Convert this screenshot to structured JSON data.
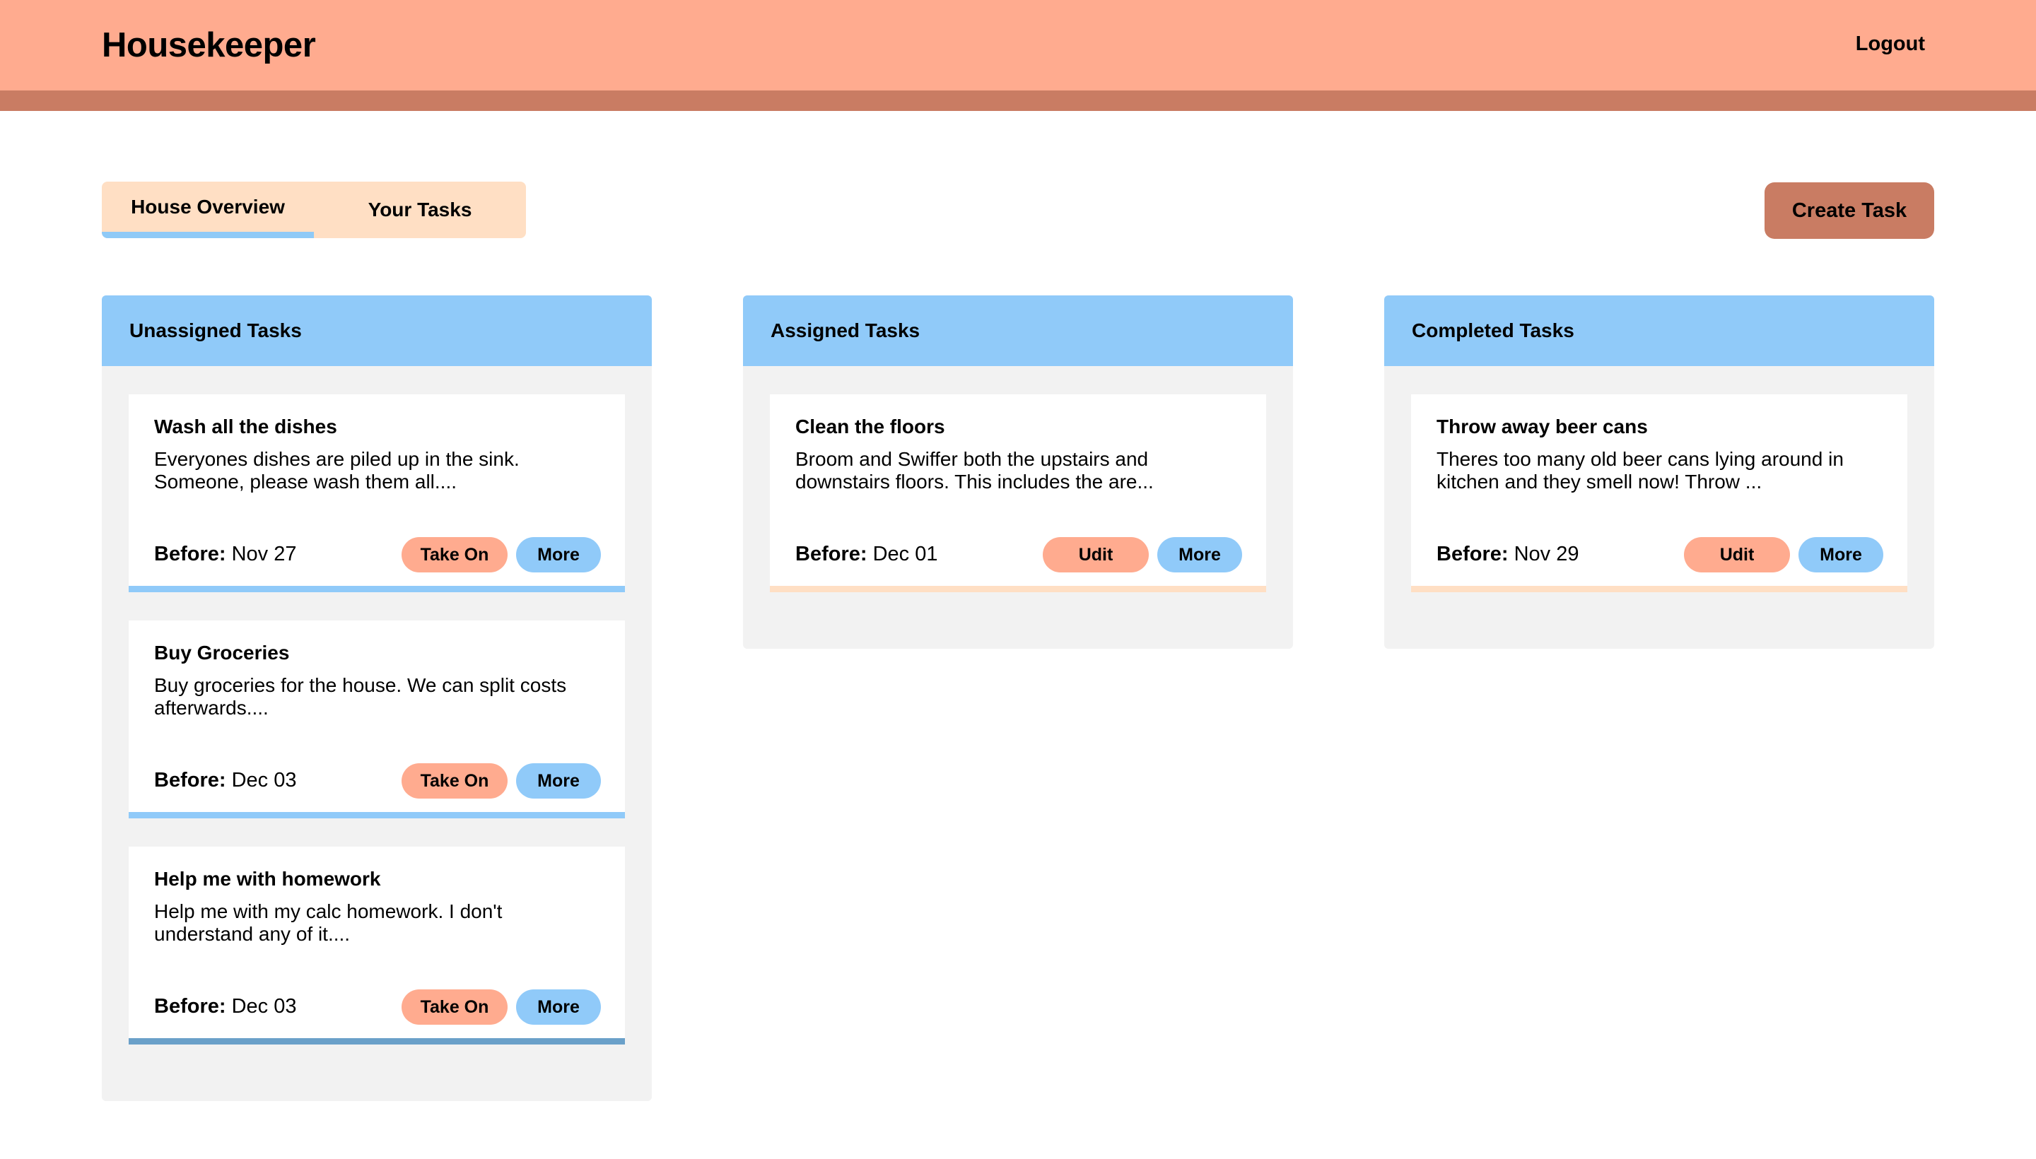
{
  "header": {
    "brand": "Housekeeper",
    "logout_label": "Logout"
  },
  "tabs": [
    {
      "label": "House Overview",
      "active": true
    },
    {
      "label": "Your Tasks",
      "active": false
    }
  ],
  "create_task_label": "Create Task",
  "colors": {
    "header_bg": "#ffab8f",
    "header_strip": "#c97c63",
    "tab_bg": "#ffdfc4",
    "column_header": "#90caf9",
    "column_bg": "#f2f2f2",
    "button_orange": "#ffab8f",
    "button_blue": "#90caf9",
    "card_bar_blue": "#90caf9",
    "card_bar_dark_blue": "#6aa0c9",
    "card_bar_peach": "#ffdfc4"
  },
  "columns": [
    {
      "title": "Unassigned Tasks",
      "cards": [
        {
          "title": "Wash all the dishes",
          "description": "Everyones dishes are piled up in the sink. Someone, please wash them all....",
          "date_label": "Before:",
          "date_value": "Nov 27",
          "primary_action": "Take On",
          "secondary_action": "More"
        },
        {
          "title": "Buy Groceries",
          "description": "Buy groceries for the house. We can split costs afterwards....",
          "date_label": "Before:",
          "date_value": "Dec 03",
          "primary_action": "Take On",
          "secondary_action": "More"
        },
        {
          "title": "Help me with homework",
          "description": "Help me with my calc homework. I don't understand any of it....",
          "date_label": "Before:",
          "date_value": "Dec 03",
          "primary_action": "Take On",
          "secondary_action": "More"
        }
      ]
    },
    {
      "title": "Assigned Tasks",
      "cards": [
        {
          "title": "Clean the floors",
          "description": "Broom and Swiffer both the upstairs and downstairs floors. This includes the are...",
          "date_label": "Before:",
          "date_value": "Dec 01",
          "primary_action": "Udit",
          "secondary_action": "More"
        }
      ]
    },
    {
      "title": "Completed Tasks",
      "cards": [
        {
          "title": "Throw away beer cans",
          "description": "Theres too many old beer cans lying around in kitchen and they smell now! Throw ...",
          "date_label": "Before:",
          "date_value": "Nov 29",
          "primary_action": "Udit",
          "secondary_action": "More"
        }
      ]
    }
  ]
}
